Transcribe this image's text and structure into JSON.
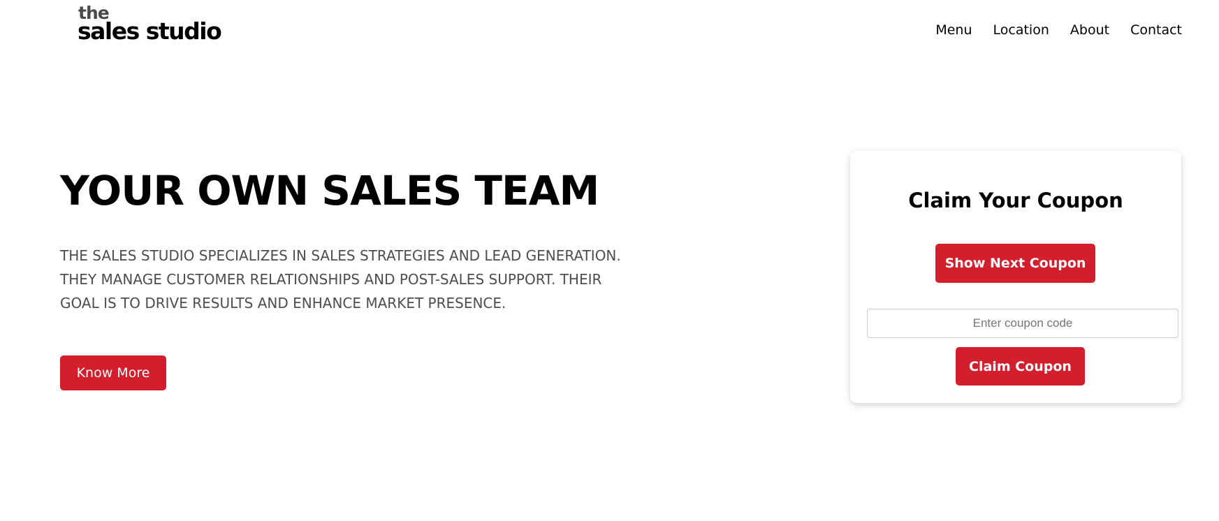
{
  "header": {
    "logo_top": "the",
    "logo_main": "sales studio",
    "nav": [
      {
        "label": "Menu"
      },
      {
        "label": "Location"
      },
      {
        "label": "About"
      },
      {
        "label": "Contact"
      }
    ]
  },
  "hero": {
    "title": "YOUR OWN SALES TEAM",
    "description": "THE SALES STUDIO SPECIALIZES IN SALES STRATEGIES AND LEAD GENERATION. THEY MANAGE CUSTOMER RELATIONSHIPS AND POST-SALES SUPPORT. THEIR GOAL IS TO DRIVE RESULTS AND ENHANCE MARKET PRESENCE.",
    "cta_label": "Know More"
  },
  "coupon": {
    "title": "Claim Your Coupon",
    "show_next_label": "Show Next Coupon",
    "input_value": "",
    "input_placeholder": "Enter coupon code",
    "claim_label": "Claim Coupon"
  },
  "colors": {
    "accent": "#d31f2d",
    "text": "#000000",
    "muted_text": "#4d4d4d",
    "background": "#ffffff"
  }
}
